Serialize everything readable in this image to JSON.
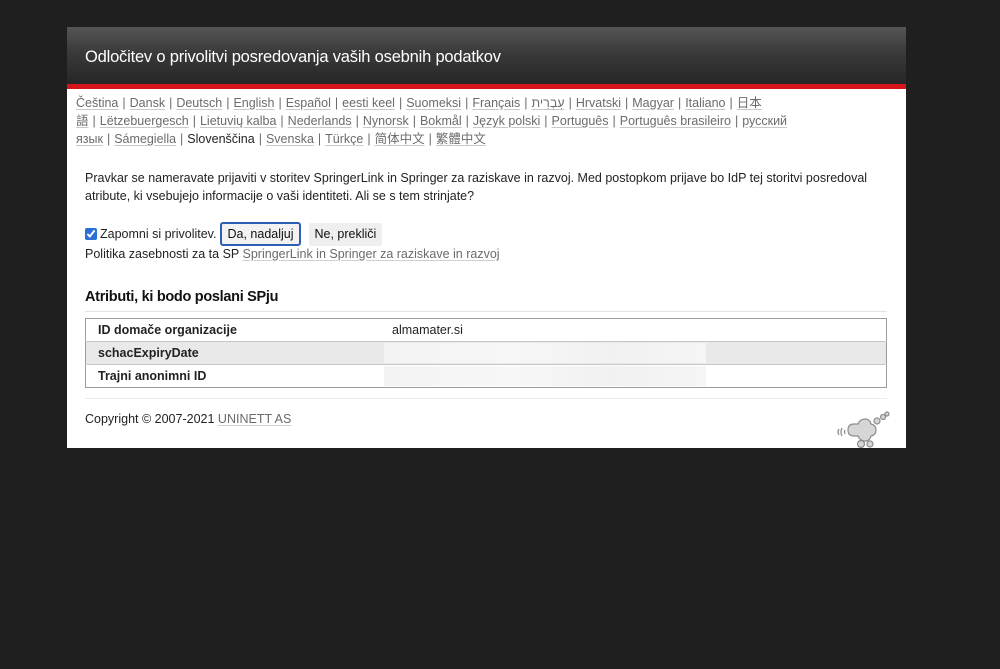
{
  "header": {
    "title": "Odločitev o privolitvi posredovanja vaših osebnih podatkov"
  },
  "languages": [
    "Čeština",
    "Dansk",
    "Deutsch",
    "English",
    "Español",
    "eesti keel",
    "Suomeksi",
    "Français",
    "עִבְרִית",
    "Hrvatski",
    "Magyar",
    "Italiano",
    "日本語",
    "Lëtzebuergesch",
    "Lietuvių kalba",
    "Nederlands",
    "Nynorsk",
    "Bokmål",
    "Język polski",
    "Português",
    "Português brasileiro",
    "русский язык",
    "Sámegiella",
    "Slovenščina",
    "Svenska",
    "Türkçe",
    "简体中文",
    "繁體中文"
  ],
  "current_language": "Slovenščina",
  "intro": "Pravkar se nameravate prijaviti v storitev SpringerLink in Springer za raziskave in razvoj. Med postopkom prijave bo IdP tej storitvi posredoval atribute, ki vsebujejo informacije o vaši identiteti. Ali se s tem strinjate?",
  "consent": {
    "remember_label": "Zapomni si privolitev.",
    "remember_checked": true,
    "yes_label": "Da, nadaljuj",
    "no_label": "Ne, prekliči"
  },
  "policy": {
    "prefix": "Politika zasebnosti za ta SP",
    "link": "SpringerLink in Springer za raziskave in razvoj"
  },
  "attributes": {
    "heading": "Atributi, ki bodo poslani SPju",
    "rows": [
      {
        "name": "ID domače organizacije",
        "value": "almamater.si"
      },
      {
        "name": "schacExpiryDate",
        "value": ""
      },
      {
        "name": "Trajni anonimni ID",
        "value": ""
      }
    ]
  },
  "footer": {
    "copyright": "Copyright © 2007-2021",
    "link": "UNINETT AS"
  },
  "colors": {
    "accent_red": "#d8141b",
    "page_bg": "#1f1f1f",
    "header_dark": "#262626"
  }
}
